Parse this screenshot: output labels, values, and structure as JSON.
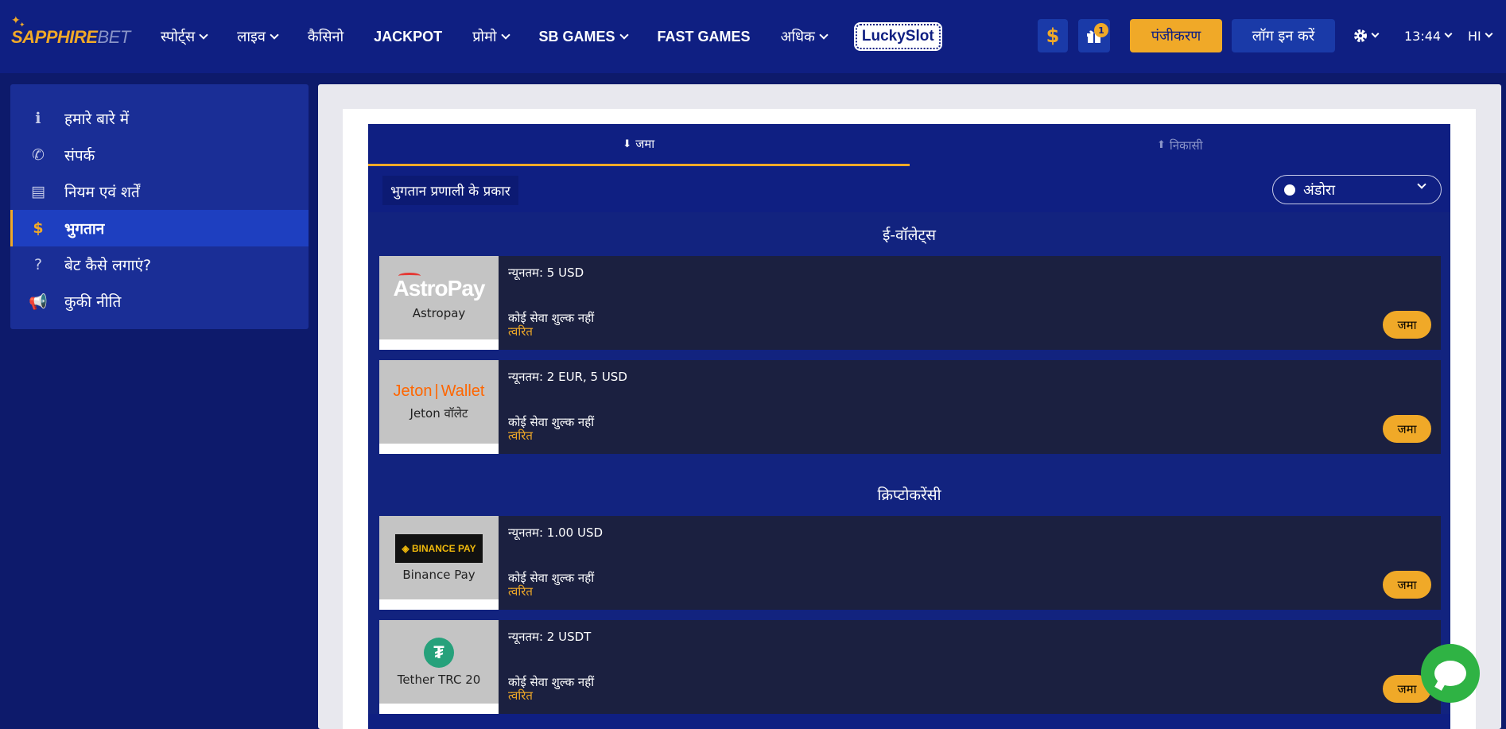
{
  "brand": {
    "logo_text_a": "SAPPHIRE",
    "logo_text_b": "BET"
  },
  "nav": [
    {
      "label": "स्पोर्ट्स",
      "has_dropdown": true
    },
    {
      "label": "लाइव",
      "has_dropdown": true
    },
    {
      "label": "कैसिनो",
      "has_dropdown": false
    },
    {
      "label": "JACKPOT",
      "has_dropdown": false
    },
    {
      "label": "प्रोमो",
      "has_dropdown": true
    },
    {
      "label": "SB GAMES",
      "has_dropdown": true
    },
    {
      "label": "FAST GAMES",
      "has_dropdown": false
    },
    {
      "label": "अधिक",
      "has_dropdown": true
    }
  ],
  "lucky_slot": "LuckySlot",
  "header": {
    "dollar_icon": "$",
    "gift_badge": "1",
    "register_label": "पंजीकरण",
    "login_label": "लॉग इन करें",
    "time": "13:44",
    "language": "HI"
  },
  "sidebar": {
    "items": [
      {
        "label": "हमारे बारे में",
        "icon": "info-icon",
        "glyph": "ℹ",
        "active": false
      },
      {
        "label": "संपर्क",
        "icon": "phone-icon",
        "glyph": "✆",
        "active": false
      },
      {
        "label": "नियम एवं शर्तें",
        "icon": "document-icon",
        "glyph": "▤",
        "active": false
      },
      {
        "label": "भुगतान",
        "icon": "dollar-icon",
        "glyph": "$",
        "active": true
      },
      {
        "label": "बेट कैसे लगाएं?",
        "icon": "question-icon",
        "glyph": "?",
        "active": false
      },
      {
        "label": "कुकी नीति",
        "icon": "megaphone-icon",
        "glyph": "📢",
        "active": false
      }
    ]
  },
  "tabs": {
    "deposit": "जमा",
    "withdrawal": "निकासी"
  },
  "toolbar": {
    "payment_types_label": "भुगतान प्रणाली के प्रकार",
    "country": "अंडोरा"
  },
  "sections": [
    {
      "title": "ई-वॉलेट्स",
      "methods": [
        {
          "name": "Astropay",
          "logo": "astropay",
          "min": "न्यूनतम: 5 USD",
          "fee": "कोई सेवा शुल्क नहीं",
          "speed": "त्वरित",
          "button": "जमा"
        },
        {
          "name": "Jeton वॉलेट",
          "logo": "jeton",
          "min": "न्यूनतम: 2 EUR, 5 USD",
          "fee": "कोई सेवा शुल्क नहीं",
          "speed": "त्वरित",
          "button": "जमा"
        }
      ]
    },
    {
      "title": "क्रिप्टोकरेंसी",
      "methods": [
        {
          "name": "Binance Pay",
          "logo": "binance",
          "min": "न्यूनतम: 1.00 USD",
          "fee": "कोई सेवा शुल्क नहीं",
          "speed": "त्वरित",
          "button": "जमा"
        },
        {
          "name": "Tether TRC 20",
          "logo": "tether",
          "min": "न्यूनतम: 2 USDT",
          "fee": "कोई सेवा शुल्क नहीं",
          "speed": "त्वरित",
          "button": "जमा"
        }
      ]
    }
  ],
  "logos": {
    "astropay_text": "AstroPay",
    "jeton_a": "Jeton",
    "jeton_b": "Wallet",
    "binance_text": "◈ BINANCE PAY",
    "tether_glyph": "₮"
  },
  "colors": {
    "header_bg": "#0f1f82",
    "accent": "#f0a928",
    "page_bg": "#0d1a6b",
    "chat": "#2fb344"
  }
}
